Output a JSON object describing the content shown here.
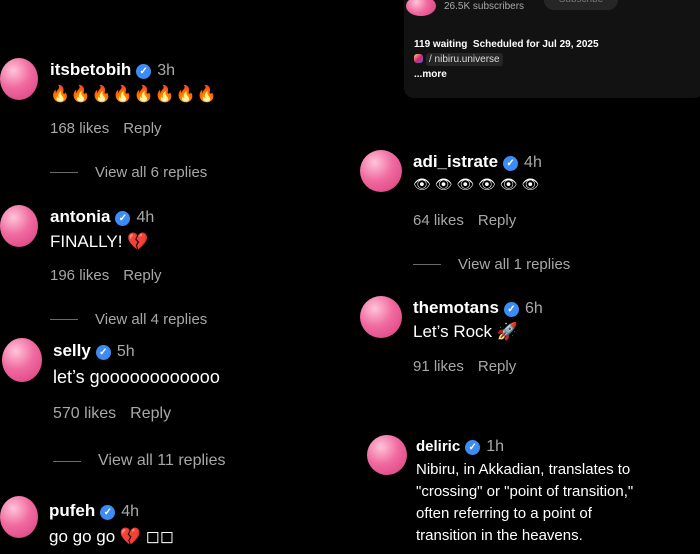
{
  "header_card": {
    "subscribers": "26.5K subscribers",
    "subscribe_label": "Subscribe",
    "waiting": "119 waiting",
    "scheduled": "Scheduled for Jul 29, 2025",
    "handle": "/ nibiru.universe",
    "more": "...more"
  },
  "comments": [
    {
      "username": "itsbetobih",
      "time": "3h",
      "text": "🔥🔥🔥🔥🔥🔥🔥🔥",
      "likes": "168 likes",
      "reply": "Reply",
      "view_all": "View all 6 replies"
    },
    {
      "username": "antonia",
      "time": "4h",
      "text": "FINALLY! 💔",
      "likes": "196 likes",
      "reply": "Reply",
      "view_all": "View all 4 replies"
    },
    {
      "username": "selly",
      "time": "5h",
      "text": "let’s goooooooooooo",
      "likes": "570 likes",
      "reply": "Reply",
      "view_all": "View all 11 replies"
    },
    {
      "username": "pufeh",
      "time": "4h",
      "text": "go go go 💔 ◻◻"
    },
    {
      "username": "adi_istrate",
      "time": "4h",
      "text": "👁 👁 👁 👁 👁 👁",
      "likes": "64 likes",
      "reply": "Reply",
      "view_all": "View all 1 replies"
    },
    {
      "username": "themotans",
      "time": "6h",
      "text": "Let’s Rock 🚀",
      "likes": "91 likes",
      "reply": "Reply"
    },
    {
      "username": "deliric",
      "time": "1h",
      "text_lines": [
        "Nibiru, in Akkadian, translates to",
        "\"crossing\" or \"point of transition,\"",
        "often referring to a point of",
        "transition in the heavens."
      ]
    }
  ]
}
